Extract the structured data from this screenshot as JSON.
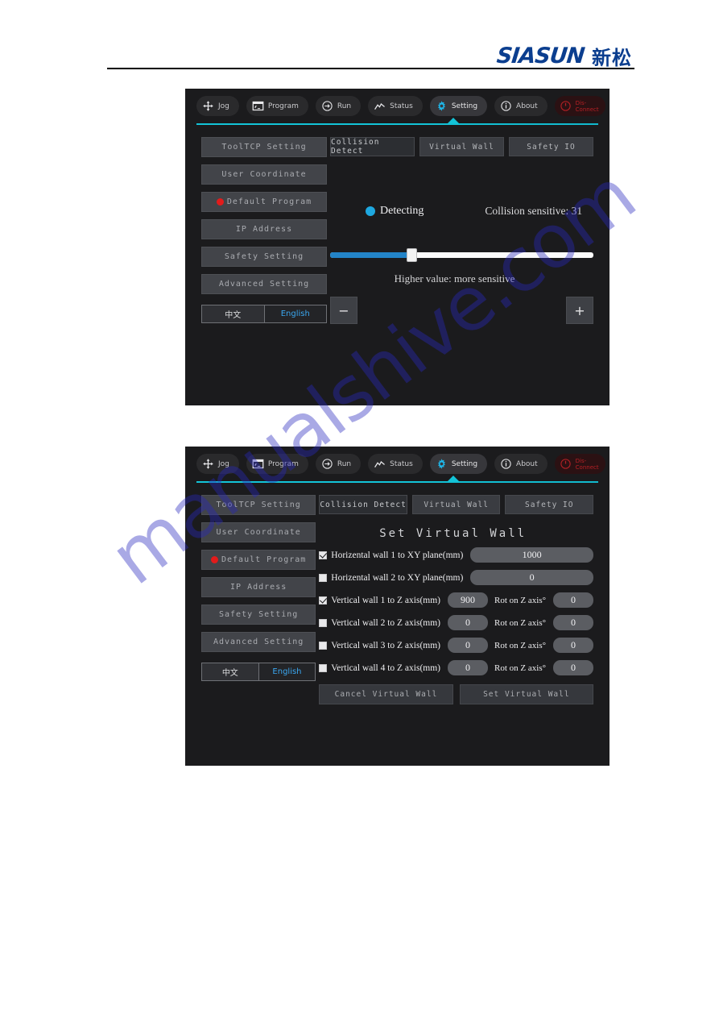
{
  "brand": {
    "latin": "SIASUN",
    "chinese": "新松"
  },
  "watermark": {
    "text": "manualshive.com"
  },
  "toolbar": {
    "items": [
      {
        "label": "Jog",
        "icon": "move-arrows-icon",
        "active": false
      },
      {
        "label": "Program",
        "icon": "program-window-icon",
        "active": false
      },
      {
        "label": "Run",
        "icon": "run-circle-icon",
        "active": false
      },
      {
        "label": "Status",
        "icon": "line-chart-icon",
        "active": false
      },
      {
        "label": "Setting",
        "icon": "gear-icon",
        "active": true
      },
      {
        "label": "About",
        "icon": "info-circle-icon",
        "active": false
      }
    ],
    "disconnect": {
      "line1": "Dis-",
      "line2": "Connect",
      "icon": "power-icon",
      "color": "#b52025"
    },
    "accent_color": "#13c4d8"
  },
  "sidebar": {
    "items": [
      {
        "label": "ToolTCP Setting",
        "dot": false
      },
      {
        "label": "User Coordinate",
        "dot": false
      },
      {
        "label": "Default Program",
        "dot": true
      },
      {
        "label": "IP Address",
        "dot": false
      },
      {
        "label": "Safety Setting",
        "dot": false
      },
      {
        "label": "Advanced Setting",
        "dot": false
      }
    ],
    "language": {
      "chinese": "中文",
      "english": "English",
      "selected": "English"
    },
    "dot_color": "#e21b1b"
  },
  "tabs": {
    "items": [
      {
        "label": "Collision Detect"
      },
      {
        "label": "Virtual Wall"
      },
      {
        "label": "Safety IO"
      }
    ]
  },
  "panel_collision": {
    "active_tab": "Collision Detect",
    "status_label": "Detecting",
    "status_dot_color": "#1ea8e0",
    "sensitivity_label": "Collision sensitive: 31",
    "sensitivity_value": 31,
    "slider_percent": 31,
    "slider_fill_color": "#2384c8",
    "hint": "Higher value: more sensitive",
    "minus_label": "−",
    "plus_label": "+"
  },
  "panel_virtual_wall": {
    "active_tab": "Virtual Wall",
    "title": "Set Virtual Wall",
    "rows": [
      {
        "label": "Horizental wall 1 to XY plane(mm)",
        "checked": true,
        "value": "1000",
        "wide": true,
        "rot_label": "",
        "rot_value": ""
      },
      {
        "label": "Horizental wall 2 to XY plane(mm)",
        "checked": false,
        "value": "0",
        "wide": true,
        "rot_label": "",
        "rot_value": ""
      },
      {
        "label": "Vertical wall 1 to Z axis(mm)",
        "checked": true,
        "value": "900",
        "wide": false,
        "rot_label": "Rot on Z axis°",
        "rot_value": "0"
      },
      {
        "label": "Vertical wall 2 to Z axis(mm)",
        "checked": false,
        "value": "0",
        "wide": false,
        "rot_label": "Rot on Z axis°",
        "rot_value": "0"
      },
      {
        "label": "Vertical wall 3 to Z axis(mm)",
        "checked": false,
        "value": "0",
        "wide": false,
        "rot_label": "Rot on Z axis°",
        "rot_value": "0"
      },
      {
        "label": "Vertical wall 4 to Z axis(mm)",
        "checked": false,
        "value": "0",
        "wide": false,
        "rot_label": "Rot on Z axis°",
        "rot_value": "0"
      }
    ],
    "cancel_label": "Cancel Virtual Wall",
    "set_label": "Set Virtual Wall"
  }
}
